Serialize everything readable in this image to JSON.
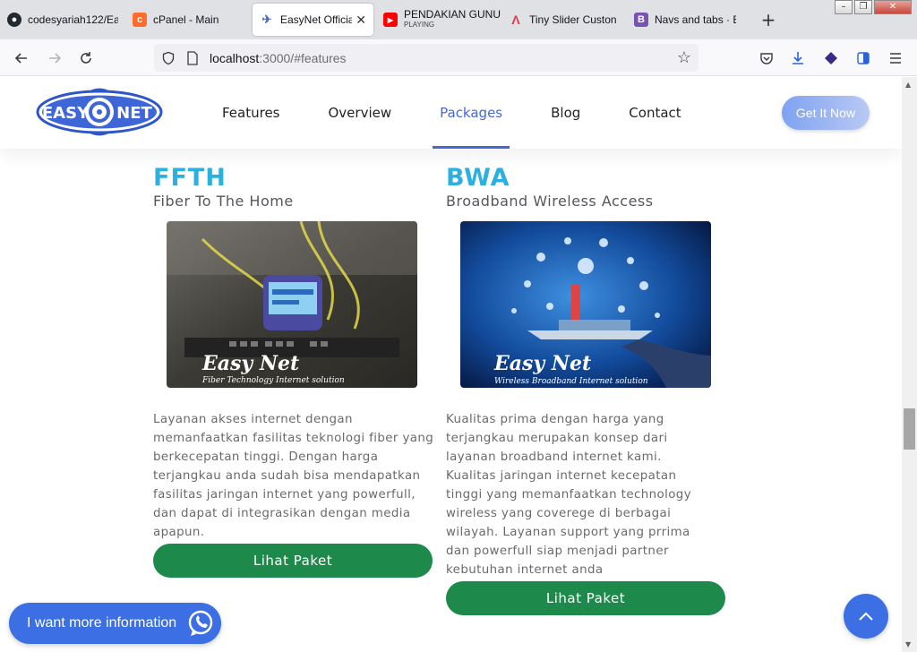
{
  "browser": {
    "tabs": [
      {
        "title": "codesyariah122/Ea",
        "icon": "github-icon"
      },
      {
        "title": "cPanel - Main",
        "icon": "cpanel-icon"
      },
      {
        "title": "EasyNet Official",
        "icon": "easynet-icon",
        "active": true
      },
      {
        "title": "PENDAKIAN GUNU",
        "subtitle": "PLAYING",
        "icon": "youtube-icon"
      },
      {
        "title": "Tiny Slider Custon",
        "icon": "tiny-slider-icon"
      },
      {
        "title": "Navs and tabs · Bo",
        "icon": "bootstrap-icon"
      }
    ],
    "url_host": "localhost",
    "url_rest": ":3000/#features"
  },
  "site": {
    "logo_left": "EASY",
    "logo_right": "NET",
    "nav": [
      {
        "label": "Features"
      },
      {
        "label": "Overview"
      },
      {
        "label": "Packages",
        "active": true
      },
      {
        "label": "Blog"
      },
      {
        "label": "Contact"
      }
    ],
    "cta_label": "Get It Now"
  },
  "packages": [
    {
      "title": "FFTH",
      "subtitle": "Fiber To The Home",
      "image_brand": "Easy Net",
      "image_tagline": "Fiber Technology Internet solution",
      "description": "Layanan akses internet dengan memanfaatkan fasilitas teknologi fiber yang berkecepatan tinggi. Dengan harga terjangkau anda sudah bisa mendapatkan fasilitas jaringan internet yang powerfull, dan dapat di integrasikan dengan media apapun.",
      "button_label": "Lihat Paket"
    },
    {
      "title": "BWA",
      "subtitle": "Broadband Wireless Access",
      "image_brand": "Easy Net",
      "image_tagline": "Wireless Broadband Internet solution",
      "description": "Kualitas prima dengan harga yang terjangkau merupakan konsep dari layanan broadband internet kami. Kualitas jaringan internet kecepatan tinggi yang memanfaatkan technology wireless yang coverege di berbagai wilayah. Layanan support yang prrima dan powerfull siap menjadi partner kebutuhan internet anda",
      "button_label": "Lihat Paket"
    }
  ],
  "whatsapp_label": "I want more information",
  "colors": {
    "brand_blue": "#4667d8",
    "title_cyan": "#2bb0e0",
    "button_green": "#1d8a4b",
    "floating_blue": "#3c6fe4"
  }
}
